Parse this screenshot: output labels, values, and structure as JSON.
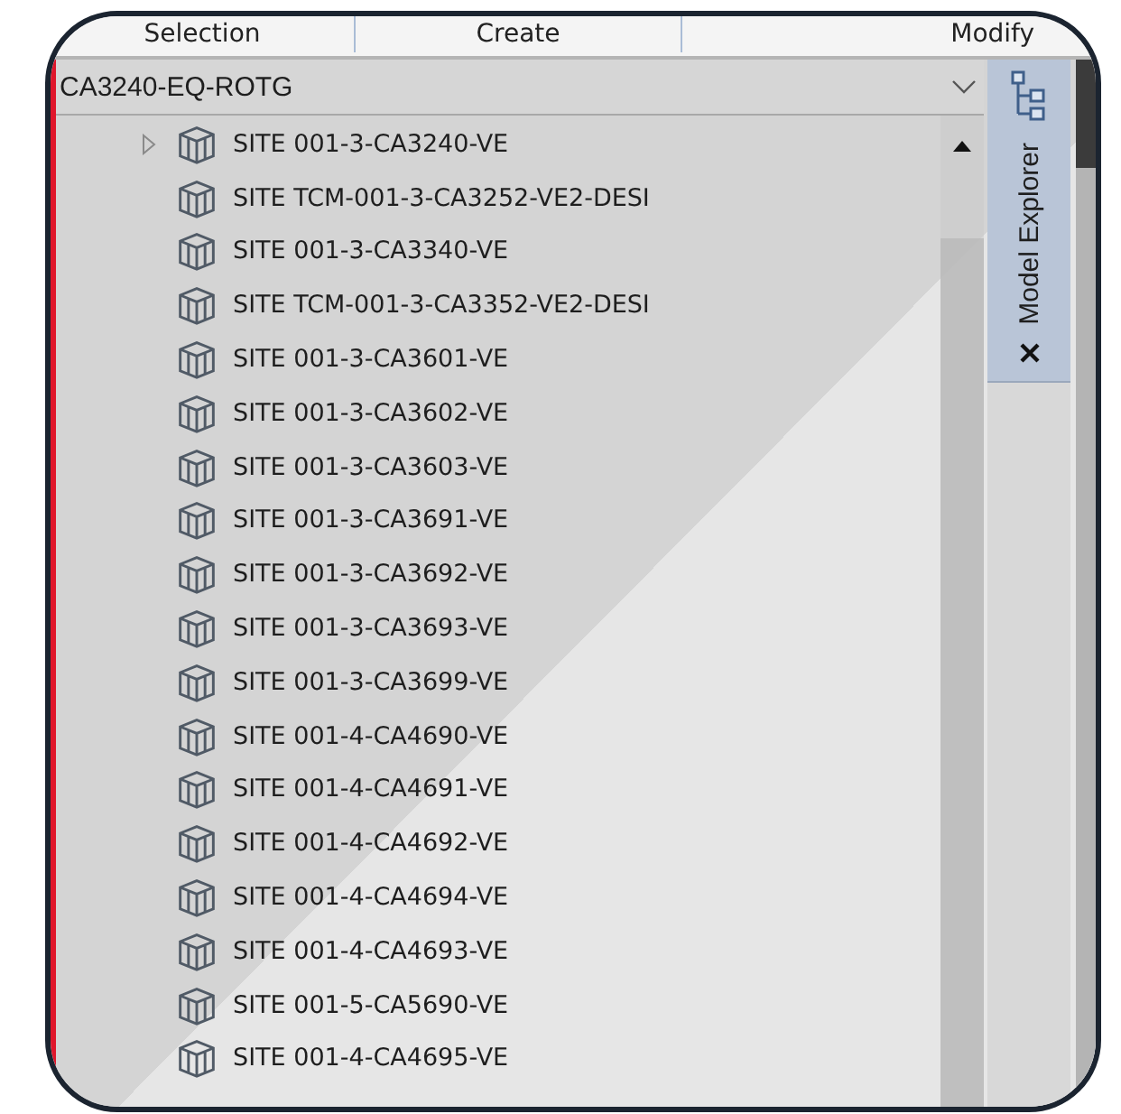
{
  "ribbon_tabs": [
    {
      "label": "Selection"
    },
    {
      "label": "Create"
    },
    {
      "label": "Modify"
    }
  ],
  "model_selector": {
    "value": "CA3240-EQ-ROTG"
  },
  "tree": {
    "items": [
      {
        "label": "SITE 001-3-CA3240-VE",
        "kind": "group",
        "expanded": false
      },
      {
        "label": "SITE TCM-001-3-CA3252-VE2-DESI",
        "kind": "leaf"
      },
      {
        "label": "SITE 001-3-CA3340-VE",
        "kind": "leaf"
      },
      {
        "label": "SITE TCM-001-3-CA3352-VE2-DESI",
        "kind": "leaf"
      },
      {
        "label": "SITE 001-3-CA3601-VE",
        "kind": "leaf"
      },
      {
        "label": "SITE 001-3-CA3602-VE",
        "kind": "leaf"
      },
      {
        "label": "SITE 001-3-CA3603-VE",
        "kind": "leaf"
      },
      {
        "label": "SITE 001-3-CA3691-VE",
        "kind": "leaf"
      },
      {
        "label": "SITE 001-3-CA3692-VE",
        "kind": "leaf"
      },
      {
        "label": "SITE 001-3-CA3693-VE",
        "kind": "leaf"
      },
      {
        "label": "SITE 001-3-CA3699-VE",
        "kind": "leaf"
      },
      {
        "label": "SITE 001-4-CA4690-VE",
        "kind": "leaf"
      },
      {
        "label": "SITE 001-4-CA4691-VE",
        "kind": "leaf"
      },
      {
        "label": "SITE 001-4-CA4692-VE",
        "kind": "leaf"
      },
      {
        "label": "SITE 001-4-CA4694-VE",
        "kind": "leaf"
      },
      {
        "label": "SITE 001-4-CA4693-VE",
        "kind": "leaf"
      },
      {
        "label": "SITE 001-5-CA5690-VE",
        "kind": "leaf"
      },
      {
        "label": "SITE 001-4-CA4695-VE",
        "kind": "leaf"
      }
    ]
  },
  "side_panel_tab": {
    "label": "Model Explorer"
  }
}
